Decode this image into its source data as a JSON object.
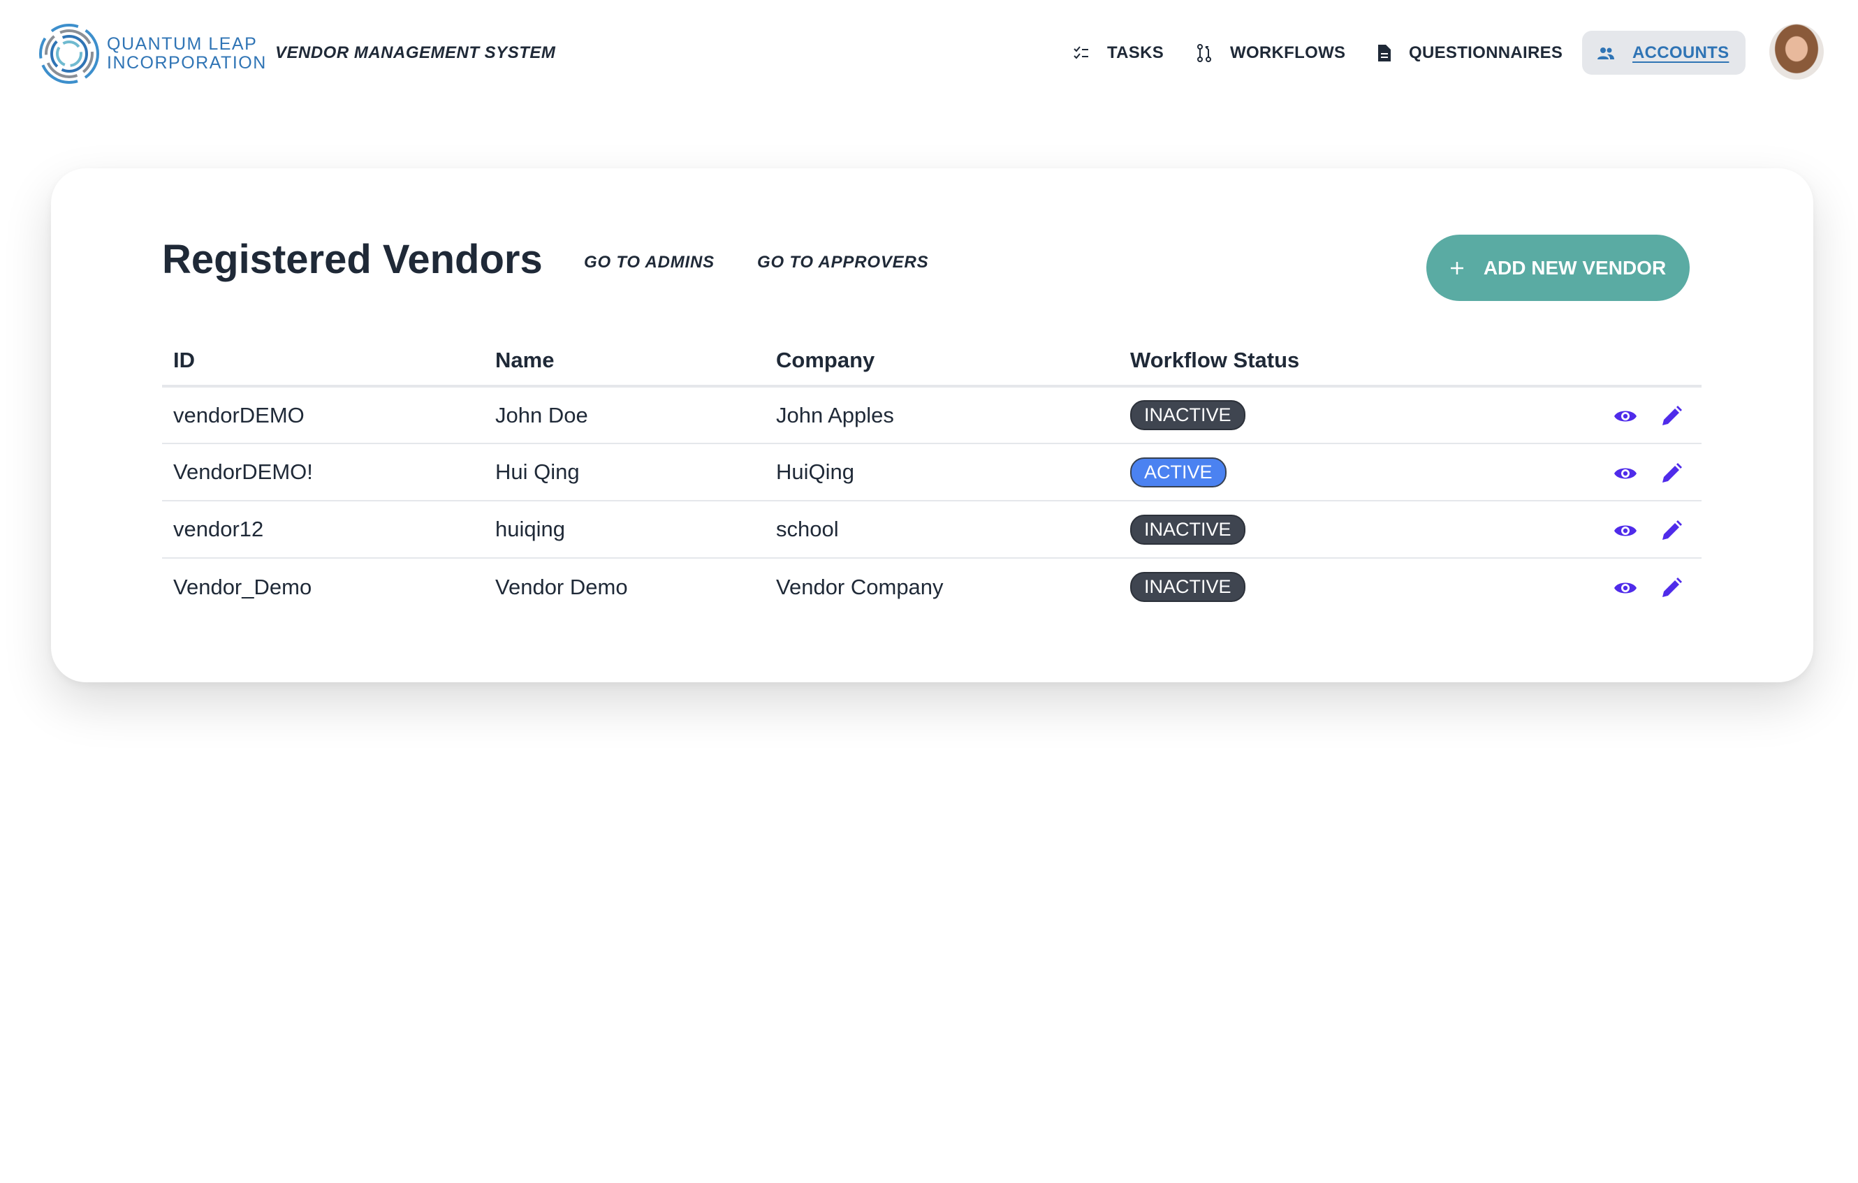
{
  "header": {
    "logo_text_line1": "QUANTUM LEAP",
    "logo_text_line2": "INCORPORATION",
    "system_title": "VENDOR MANAGEMENT SYSTEM",
    "nav": [
      {
        "label": "TASKS",
        "icon": "checklist-icon"
      },
      {
        "label": "WORKFLOWS",
        "icon": "git-pull-request-icon"
      },
      {
        "label": "QUESTIONNAIRES",
        "icon": "document-icon"
      },
      {
        "label": "ACCOUNTS",
        "icon": "users-icon",
        "active": true
      }
    ]
  },
  "main": {
    "title": "Registered Vendors",
    "go_to_admins": "GO TO ADMINS",
    "go_to_approvers": "GO TO APPROVERS",
    "add_button": "ADD NEW VENDOR",
    "table": {
      "headers": [
        "ID",
        "Name",
        "Company",
        "Workflow Status"
      ],
      "rows": [
        {
          "id": "vendorDEMO",
          "name": "John Doe",
          "company": "John Apples",
          "status": "INACTIVE"
        },
        {
          "id": "VendorDEMO!",
          "name": "Hui Qing",
          "company": "HuiQing",
          "status": "ACTIVE"
        },
        {
          "id": "vendor12",
          "name": "huiqing",
          "company": "school",
          "status": "INACTIVE"
        },
        {
          "id": "Vendor_Demo",
          "name": "Vendor Demo",
          "company": "Vendor Company",
          "status": "INACTIVE"
        }
      ]
    }
  },
  "colors": {
    "accent": "#5aaba3",
    "brand": "#2f74b5",
    "action_icons": "#4f2bea",
    "active_badge": "#4b82f1",
    "inactive_badge": "#3f4550"
  }
}
